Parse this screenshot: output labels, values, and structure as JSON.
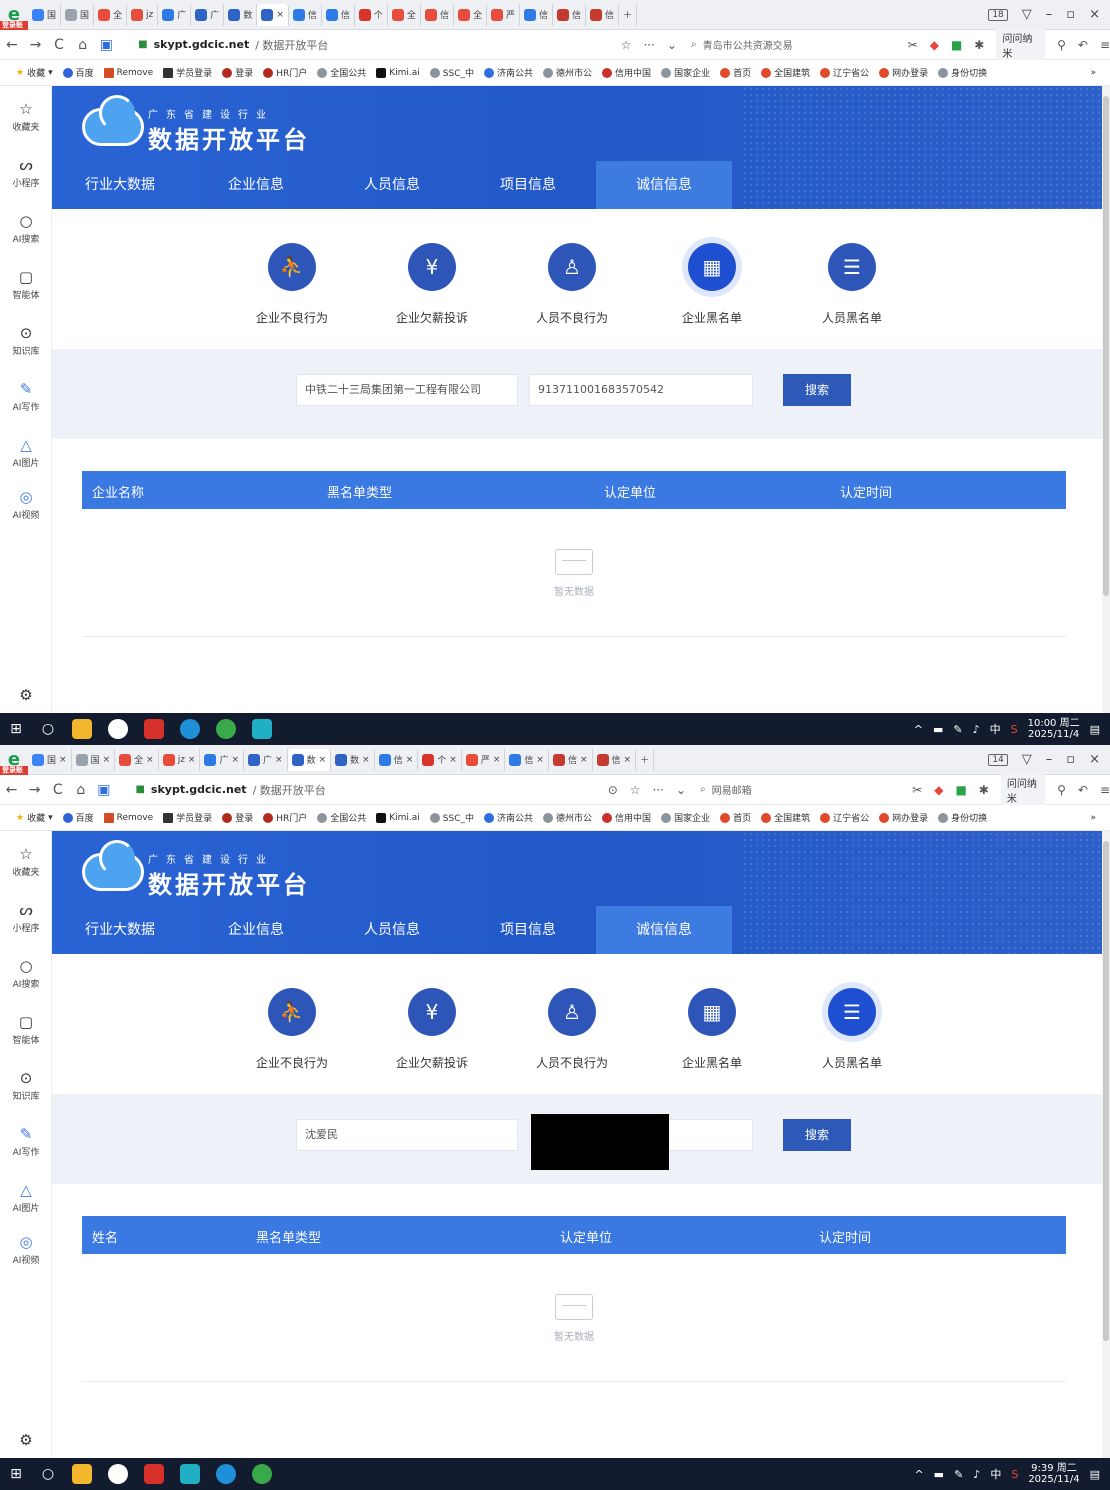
{
  "browser": {
    "badge": "登录账号",
    "tab_count_1": "18",
    "tab_count_2": "14",
    "url_host": "skypt.gdcic.net",
    "url_path": "/ 数据开放平台",
    "search_1": "青岛市公共资源交易",
    "search_2": "网易邮箱",
    "ask": "问问纳米",
    "tabs": [
      "国",
      "国",
      "全",
      "jz",
      "广",
      "广",
      "数",
      "信",
      "信",
      "个",
      "全",
      "信",
      "全",
      "严",
      "信",
      "信",
      "信"
    ],
    "bookmarks": [
      "收藏",
      "百度",
      "Remove",
      "学员登录",
      "登录",
      "HR门户",
      "全国公共",
      "Kimi.ai",
      "SSC_中",
      "济南公共",
      "德州市公",
      "信用中国",
      "国家企业",
      "首页",
      "全国建筑",
      "辽宁省公",
      "网办登录",
      "身份切换"
    ]
  },
  "sidebar": [
    "收藏夹",
    "小程序",
    "AI搜索",
    "智能体",
    "知识库",
    "AI写作",
    "AI图片",
    "AI视频"
  ],
  "site": {
    "brand_small": "广东省建设行业",
    "brand_big": "数据开放平台",
    "nav": [
      "行业大数据",
      "企业信息",
      "人员信息",
      "项目信息",
      "诚信信息"
    ],
    "categories": [
      "企业不良行为",
      "企业欠薪投诉",
      "人员不良行为",
      "企业黑名单",
      "人员黑名单"
    ],
    "search_btn": "搜索",
    "empty": "暂无数据"
  },
  "view1": {
    "selected": "企业黑名单",
    "input_name": "中铁二十三局集团第一工程有限公司",
    "input_code": "913711001683570542",
    "columns": [
      "企业名称",
      "黑名单类型",
      "认定单位",
      "认定时间"
    ]
  },
  "view2": {
    "selected": "人员黑名单",
    "input_name": "沈爱民",
    "input_code": "",
    "columns": [
      "姓名",
      "黑名单类型",
      "认定单位",
      "认定时间"
    ]
  },
  "taskbar": {
    "time_1": "10:00 周二",
    "date_1": "2025/11/4",
    "time_2": "9:39 周二",
    "date_2": "2025/11/4",
    "ime": "中"
  }
}
